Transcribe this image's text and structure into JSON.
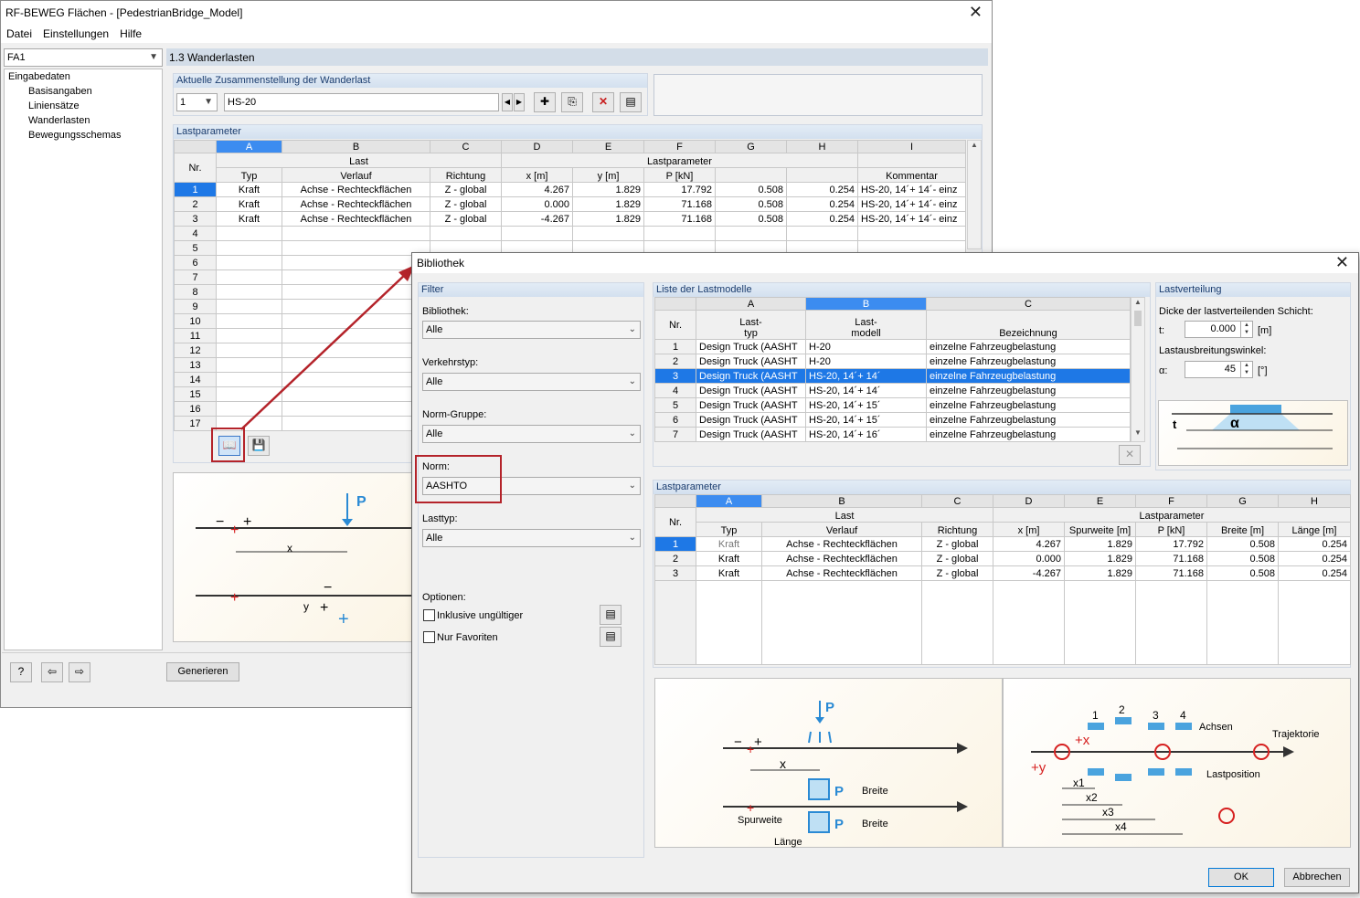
{
  "main": {
    "title": "RF-BEWEG Flächen - [PedestrianBridge_Model]",
    "menu": [
      "Datei",
      "Einstellungen",
      "Hilfe"
    ],
    "case_combo": "FA1",
    "section_title": "1.3 Wanderlasten",
    "tree": {
      "root": "Eingabedaten",
      "items": [
        "Basisangaben",
        "Liniensätze",
        "Wanderlasten",
        "Bewegungsschemas"
      ]
    },
    "composition": {
      "header": "Aktuelle Zusammenstellung der Wanderlast",
      "number": "1",
      "name": "HS-20"
    },
    "lastparameter": {
      "header": "Lastparameter",
      "col_letters": [
        "A",
        "B",
        "C",
        "D",
        "E",
        "F",
        "G",
        "H",
        "I"
      ],
      "group_last": "Last",
      "group_param": "Lastparameter",
      "nr": "Nr.",
      "cols": [
        "Typ",
        "Verlauf",
        "Richtung",
        "x [m]",
        "y [m]",
        "P [kN]",
        "",
        "",
        "Kommentar"
      ],
      "rows": [
        [
          "1",
          "Kraft",
          "Achse - Rechteckflächen",
          "Z - global",
          "4.267",
          "1.829",
          "17.792",
          "0.508",
          "0.254",
          "HS-20, 14´+ 14´- einz"
        ],
        [
          "2",
          "Kraft",
          "Achse - Rechteckflächen",
          "Z - global",
          "0.000",
          "1.829",
          "71.168",
          "0.508",
          "0.254",
          "HS-20, 14´+ 14´- einz"
        ],
        [
          "3",
          "Kraft",
          "Achse - Rechteckflächen",
          "Z - global",
          "-4.267",
          "1.829",
          "71.168",
          "0.508",
          "0.254",
          "HS-20, 14´+ 14´- einz"
        ]
      ],
      "empty_rows": [
        "4",
        "5",
        "6",
        "7",
        "8",
        "9",
        "10",
        "11",
        "12",
        "13",
        "14",
        "15",
        "16",
        "17"
      ]
    },
    "footer_button": "Generieren",
    "diagram": {
      "p": "P",
      "x": "x",
      "y": "y"
    }
  },
  "dialog": {
    "title": "Bibliothek",
    "filter": {
      "header": "Filter",
      "bibliothek_label": "Bibliothek:",
      "bibliothek": "Alle",
      "verkehrstyp_label": "Verkehrstyp:",
      "verkehrstyp": "Alle",
      "normgruppe_label": "Norm-Gruppe:",
      "normgruppe": "Alle",
      "norm_label": "Norm:",
      "norm": "AASHTO",
      "lasttyp_label": "Lasttyp:",
      "lasttyp": "Alle",
      "optionen_label": "Optionen:",
      "opt1": "Inklusive ungültiger",
      "opt2": "Nur Favoriten"
    },
    "models": {
      "header": "Liste der Lastmodelle",
      "col_letters": [
        "A",
        "B",
        "C"
      ],
      "nr": "Nr.",
      "h_a1": "Last-",
      "h_a2": "typ",
      "h_b1": "Last-",
      "h_b2": "modell",
      "h_c": "Bezeichnung",
      "rows": [
        [
          "1",
          "Design Truck (AASHT",
          "H-20",
          "einzelne Fahrzeugbelastung"
        ],
        [
          "2",
          "Design Truck (AASHT",
          "H-20",
          "einzelne Fahrzeugbelastung"
        ],
        [
          "3",
          "Design Truck (AASHT",
          "HS-20, 14´+ 14´",
          "einzelne Fahrzeugbelastung"
        ],
        [
          "4",
          "Design Truck (AASHT",
          "HS-20, 14´+ 14´",
          "einzelne Fahrzeugbelastung"
        ],
        [
          "5",
          "Design Truck (AASHT",
          "HS-20, 14´+ 15´",
          "einzelne Fahrzeugbelastung"
        ],
        [
          "6",
          "Design Truck (AASHT",
          "HS-20, 14´+ 15´",
          "einzelne Fahrzeugbelastung"
        ],
        [
          "7",
          "Design Truck (AASHT",
          "HS-20, 14´+ 16´",
          "einzelne Fahrzeugbelastung"
        ]
      ]
    },
    "distribution": {
      "header": "Lastverteilung",
      "thickness_label": "Dicke der lastverteilenden Schicht:",
      "t_label": "t:",
      "t_value": "0.000",
      "t_unit": "[m]",
      "angle_label": "Lastausbreitungswinkel:",
      "a_label": "α:",
      "a_value": "45",
      "a_unit": "[°]",
      "sym_t": "t",
      "sym_a": "α"
    },
    "params": {
      "header": "Lastparameter",
      "col_letters": [
        "A",
        "B",
        "C",
        "D",
        "E",
        "F",
        "G",
        "H"
      ],
      "group_last": "Last",
      "group_param": "Lastparameter",
      "nr": "Nr.",
      "cols": [
        "Typ",
        "Verlauf",
        "Richtung",
        "x [m]",
        "Spurweite [m]",
        "P [kN]",
        "Breite [m]",
        "Länge [m]"
      ],
      "rows": [
        [
          "1",
          "Kraft",
          "Achse - Rechteckflächen",
          "Z - global",
          "4.267",
          "1.829",
          "17.792",
          "0.508",
          "0.254"
        ],
        [
          "2",
          "Kraft",
          "Achse - Rechteckflächen",
          "Z - global",
          "0.000",
          "1.829",
          "71.168",
          "0.508",
          "0.254"
        ],
        [
          "3",
          "Kraft",
          "Achse - Rechteckflächen",
          "Z - global",
          "-4.267",
          "1.829",
          "71.168",
          "0.508",
          "0.254"
        ]
      ]
    },
    "diag_left": {
      "p": "P",
      "x": "x",
      "breite": "Breite",
      "spurweite": "Spurweite",
      "laenge": "Länge"
    },
    "diag_right": {
      "axes": [
        "1",
        "2",
        "3",
        "4"
      ],
      "achsen": "Achsen",
      "trajektorie": "Trajektorie",
      "lastposition": "Lastposition",
      "px": "+x",
      "py": "+y",
      "x1": "x1",
      "x2": "x2",
      "x3": "x3",
      "x4": "x4"
    },
    "ok": "OK",
    "cancel": "Abbrechen"
  }
}
